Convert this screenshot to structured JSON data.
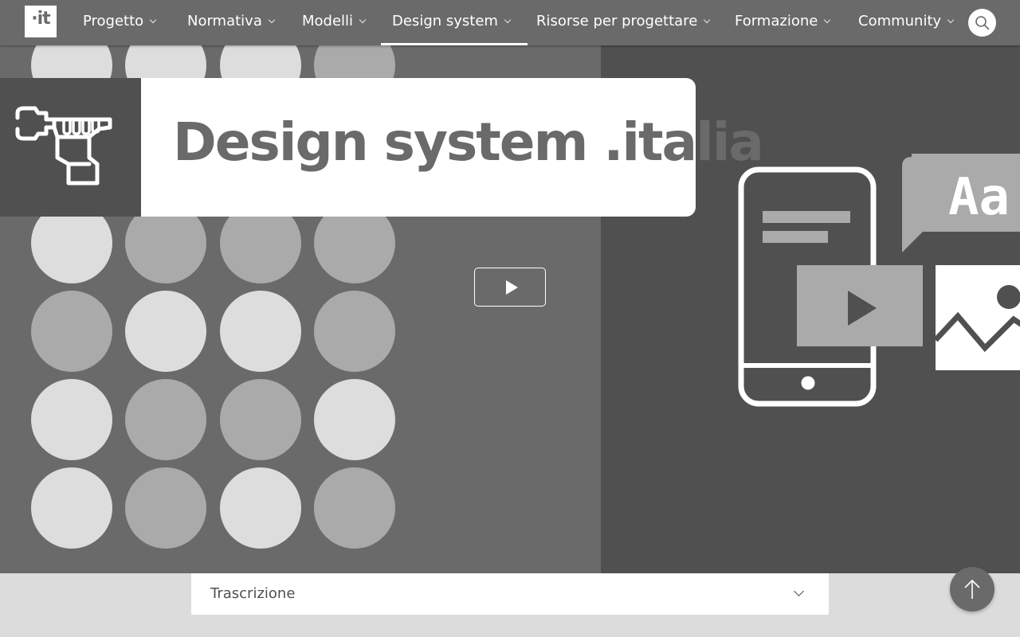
{
  "nav": {
    "logo_text": "·it",
    "items": [
      {
        "label": "Progetto",
        "has_dropdown": true,
        "active": false
      },
      {
        "label": "Normativa",
        "has_dropdown": true,
        "active": false
      },
      {
        "label": "Modelli",
        "has_dropdown": true,
        "active": false
      },
      {
        "label": "Design system",
        "has_dropdown": true,
        "active": true
      },
      {
        "label": "Risorse per progettare",
        "has_dropdown": true,
        "active": false
      },
      {
        "label": "Formazione",
        "has_dropdown": true,
        "active": false
      },
      {
        "label": "Community",
        "has_dropdown": true,
        "active": false
      }
    ],
    "search_icon": "search-icon"
  },
  "hero": {
    "title": "Design system .italia",
    "title_icon": "wrench-hand-icon",
    "play_icon": "play-icon",
    "illustration": {
      "bubble_text": "Aa",
      "icons": [
        "smartphone-icon",
        "video-icon",
        "image-icon",
        "speech-bubble-icon"
      ]
    },
    "colors": {
      "left_panel": "#6a6a6a",
      "right_panel": "#505050",
      "dot_light": "#dddddd",
      "dot_mid": "#aaaaaa"
    }
  },
  "transcript": {
    "label": "Trascrizione",
    "expand_icon": "chevron-down-icon"
  },
  "back_to_top": {
    "icon": "arrow-up-icon"
  }
}
